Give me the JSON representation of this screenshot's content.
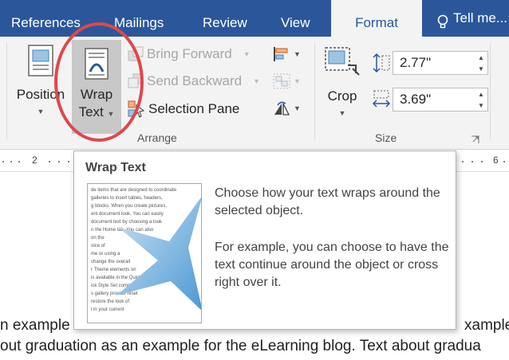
{
  "tabs": [
    {
      "label": "References"
    },
    {
      "label": "Mailings"
    },
    {
      "label": "Review"
    },
    {
      "label": "View"
    },
    {
      "label": "Format"
    },
    {
      "label": "Tell me..."
    }
  ],
  "ribbon": {
    "position_label": "Position",
    "wrap_label_1": "Wrap",
    "wrap_label_2": "Text",
    "bring_forward": "Bring Forward",
    "send_backward": "Send Backward",
    "selection_pane": "Selection Pane",
    "arrange_group": "Arrange",
    "crop_label": "Crop",
    "height_value": "2.77\"",
    "width_value": "3.69\"",
    "size_group": "Size"
  },
  "ruler": {
    "ticks": [
      "2",
      "6"
    ]
  },
  "document": {
    "line1_left": "n example",
    "line1_right": "xample",
    "line2": "out graduation as an example for the eLearning blog. Text about gradua"
  },
  "tooltip": {
    "title": "Wrap Text",
    "text1": "Choose how your text wraps around the selected object.",
    "text2": "For example, you can choose to have the text continue around the object or cross right over it.",
    "thumb_lines": [
      "de items that are designed to coordinate",
      "galleries to insert tables, headers,",
      "g blocks. When you create pictures,",
      "ent document look. You can easily",
      "document text by choosing a look",
      "n the Home tab. You can also",
      "on the",
      "oice of",
      "me or using a",
      "change the overall",
      "r Theme elements on",
      "is available in the Quick",
      "ick Style Set command.",
      "s gallery provide reset",
      "restore the look of",
      "l in your current"
    ]
  },
  "colors": {
    "ribbon_blue": "#2b579a",
    "highlight_ring": "#e0474c"
  }
}
